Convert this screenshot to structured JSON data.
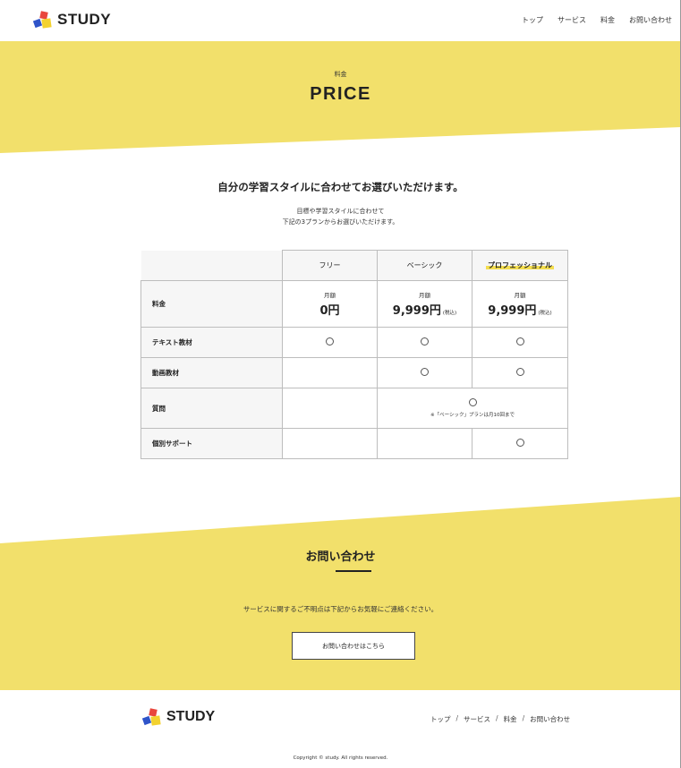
{
  "header": {
    "logo_text": "STUDY",
    "nav": [
      "トップ",
      "サービス",
      "料金",
      "お問い合わせ"
    ]
  },
  "hero": {
    "subtitle": "料金",
    "title": "PRICE"
  },
  "lead": {
    "title": "自分の学習スタイルに合わせてお選びいただけます。",
    "line1": "目標や学習スタイルに合わせて",
    "line2": "下記の3プランからお選びいただけます。"
  },
  "table": {
    "plans": [
      "フリー",
      "ベーシック",
      "プロフェッショナル"
    ],
    "rows": {
      "price_label": "料金",
      "monthly": "月額",
      "prices": [
        "0円",
        "9,999円",
        "9,999円"
      ],
      "tax": "(税込)",
      "text_label": "テキスト教材",
      "video_label": "動画教材",
      "question_label": "質問",
      "question_note": "※「ベーシック」プランは月10回まで",
      "support_label": "個別サポート"
    },
    "mark": "○"
  },
  "contact": {
    "title": "お問い合わせ",
    "text": "サービスに関するご不明点は下記からお気軽にご連絡ください。",
    "button": "お問い合わせはこちら"
  },
  "footer": {
    "logo_text": "STUDY",
    "nav": [
      "トップ",
      "サービス",
      "料金",
      "お問い合わせ"
    ],
    "separator": "/",
    "copyright": "Copyright © study. All rights reserved."
  },
  "colors": {
    "accent_yellow": "#f2e06b",
    "highlight_yellow": "#f4de4f",
    "logo_red": "#e9463c",
    "logo_blue": "#2f54c9"
  }
}
